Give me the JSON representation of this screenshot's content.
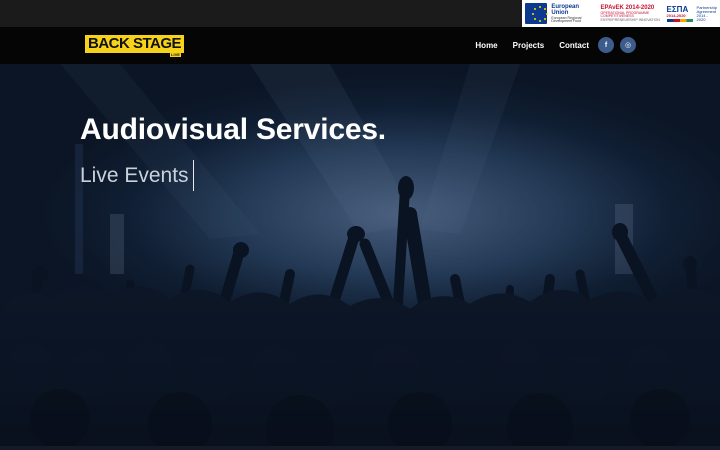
{
  "topbar": {
    "eu_title": "European Union",
    "eu_sub": "European Regional Development Fund",
    "epanek_title": "ΕΡΑνΕΚ 2014-2020",
    "epanek_sub": "OPERATIONAL PROGRAMME COMPETITIVENESS",
    "epanek_sub2": "ENTREPRENEURSHIP INNOVATION",
    "espa_title": "ΕΣΠΑ",
    "espa_years": "2014-2020",
    "partner_line1": "Partnership",
    "partner_line2": "Agreement",
    "partner_line3": "2014 - 2020"
  },
  "brand": {
    "logo_text": "BACK STAGE",
    "logo_sub": "LIVE"
  },
  "nav": {
    "items": [
      "Home",
      "Projects",
      "Contact"
    ],
    "social": [
      {
        "icon": "facebook-icon",
        "glyph": "f"
      },
      {
        "icon": "instagram-icon",
        "glyph": "◎"
      }
    ]
  },
  "hero": {
    "title": "Audiovisual Services.",
    "subtitle": "Live Events"
  },
  "colors": {
    "logo_yellow": "#f7d21a",
    "social_bg": "#3d5c8c",
    "nav_bg": "#050505",
    "hero_blue": "#2c4766"
  }
}
